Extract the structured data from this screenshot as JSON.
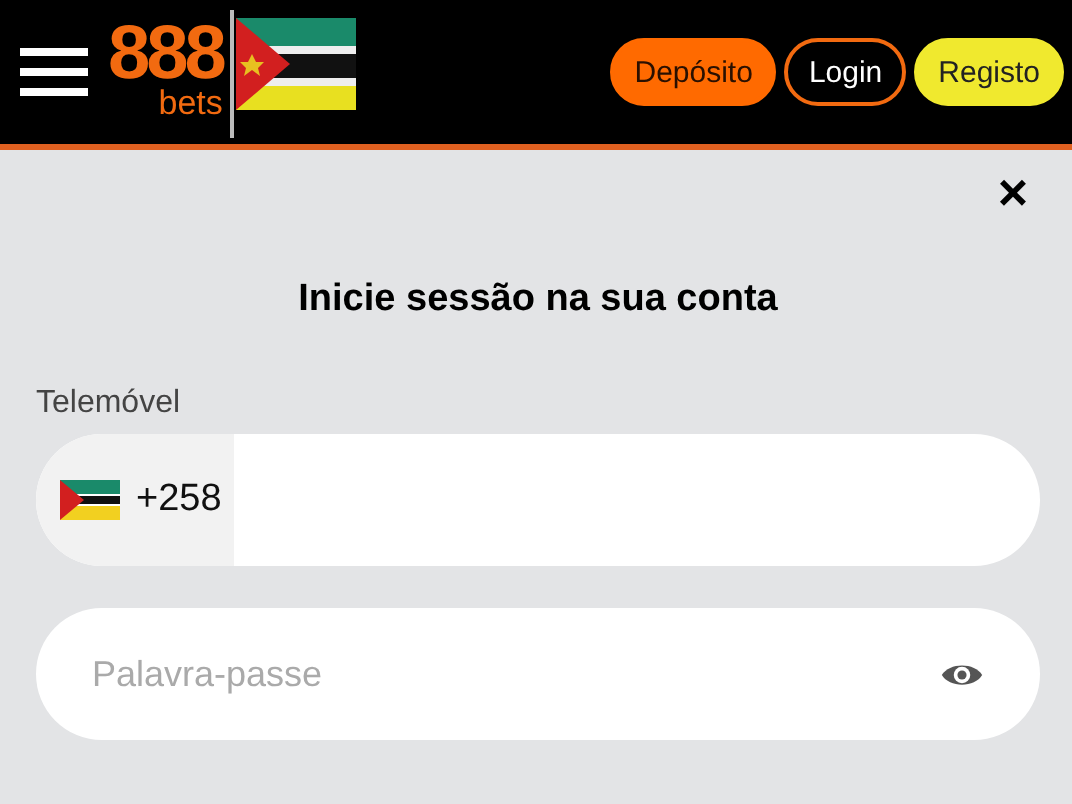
{
  "header": {
    "logo": {
      "digits": "888",
      "word": "bets"
    },
    "buttons": [
      {
        "kind": "deposit",
        "label": "Depósito"
      },
      {
        "kind": "login",
        "label": "Login"
      },
      {
        "kind": "register",
        "label": "Registo"
      }
    ]
  },
  "dialog": {
    "close": "×",
    "title": "Inicie sessão na sua conta",
    "phone": {
      "label": "Telemóvel",
      "prefix": "+258"
    },
    "password": {
      "placeholder": "Palavra-passe"
    }
  }
}
